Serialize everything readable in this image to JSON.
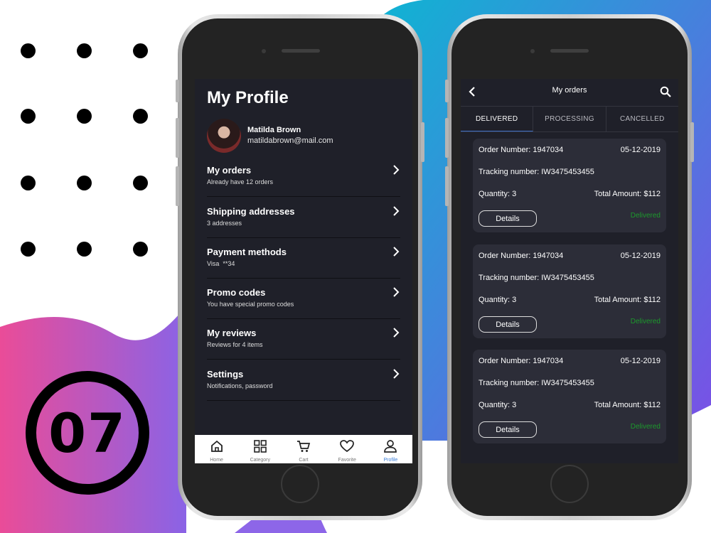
{
  "badge": {
    "number": "07"
  },
  "profile": {
    "title": "My Profile",
    "user": {
      "name": "Matilda Brown",
      "email": "matildabrown@mail.com"
    },
    "menu": [
      {
        "title": "My orders",
        "subtitle": "Already have 12 orders"
      },
      {
        "title": "Shipping addresses",
        "subtitle": "3 addresses"
      },
      {
        "title": "Payment methods",
        "subtitle": "Visa  **34"
      },
      {
        "title": "Promo codes",
        "subtitle": "You have special promo codes"
      },
      {
        "title": "My reviews",
        "subtitle": "Reviews for 4 items"
      },
      {
        "title": "Settings",
        "subtitle": "Notifications, password"
      }
    ],
    "tabbar": [
      {
        "label": "Home",
        "icon": "home-icon"
      },
      {
        "label": "Category",
        "icon": "grid-icon"
      },
      {
        "label": "Cart",
        "icon": "cart-icon"
      },
      {
        "label": "Favorite",
        "icon": "heart-icon"
      },
      {
        "label": "Profile",
        "icon": "user-icon",
        "active": true
      }
    ]
  },
  "orders": {
    "title": "My orders",
    "tabs": [
      {
        "label": "DELIVERED",
        "active": true
      },
      {
        "label": "PROCESSING"
      },
      {
        "label": "CANCELLED"
      }
    ],
    "list": [
      {
        "order_label": "Order Number: 1947034",
        "date": "05-12-2019",
        "tracking": "Tracking number: IW3475453455",
        "quantity": "Quantity: 3",
        "total": "Total Amount: $112",
        "details": "Details",
        "status": "Delivered"
      },
      {
        "order_label": "Order Number: 1947034",
        "date": "05-12-2019",
        "tracking": "Tracking number: IW3475453455",
        "quantity": "Quantity: 3",
        "total": "Total Amount: $112",
        "details": "Details",
        "status": "Delivered"
      },
      {
        "order_label": "Order Number: 1947034",
        "date": "05-12-2019",
        "tracking": "Tracking number: IW3475453455",
        "quantity": "Quantity: 3",
        "total": "Total Amount: $112",
        "details": "Details",
        "status": "Delivered"
      }
    ]
  },
  "colors": {
    "screen_bg": "#1f2029",
    "card_bg": "#2c2d38",
    "accent_blue": "#3d7fd8",
    "delivered_green": "#1c9a2c",
    "pink": "#e84f9a",
    "violet": "#7b5ce8",
    "cyan": "#14b1d6"
  }
}
